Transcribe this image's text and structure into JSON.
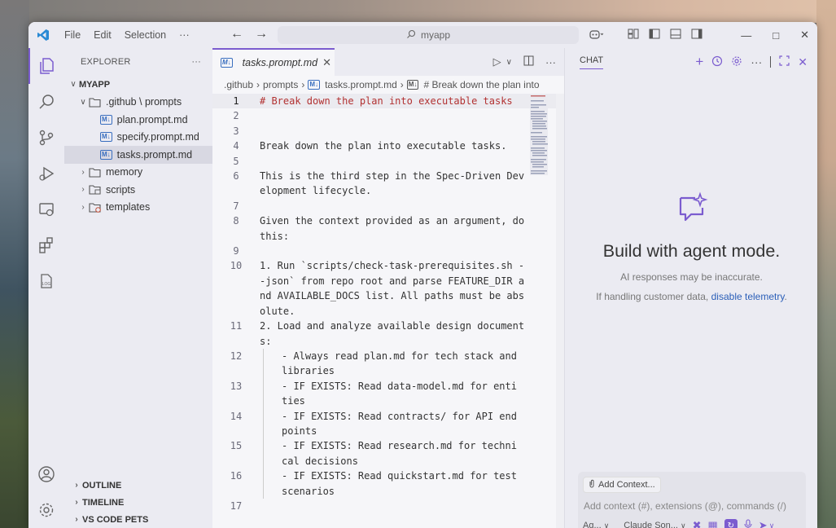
{
  "menu": [
    "File",
    "Edit",
    "Selection",
    "···"
  ],
  "search": {
    "text": "myapp"
  },
  "sidebar": {
    "title": "EXPLORER",
    "more": "···",
    "root": "MYAPP",
    "tree": [
      {
        "label": ".github \\ prompts",
        "type": "folder-open",
        "indent": 1
      },
      {
        "label": "plan.prompt.md",
        "type": "md",
        "indent": 2
      },
      {
        "label": "specify.prompt.md",
        "type": "md",
        "indent": 2
      },
      {
        "label": "tasks.prompt.md",
        "type": "md",
        "indent": 2,
        "selected": true
      },
      {
        "label": "memory",
        "type": "folder",
        "indent": 1
      },
      {
        "label": "scripts",
        "type": "folder-scripts",
        "indent": 1
      },
      {
        "label": "templates",
        "type": "folder-templates",
        "indent": 1
      }
    ],
    "sections": [
      "OUTLINE",
      "TIMELINE",
      "VS CODE PETS"
    ]
  },
  "editor": {
    "tab_label": "tasks.prompt.md",
    "md_badge": "M↓",
    "breadcrumbs": [
      ".github",
      "prompts",
      "tasks.prompt.md",
      "# Break down the plan into"
    ],
    "lines": [
      {
        "n": "1",
        "text": "# Break down the plan into executable tasks",
        "heading": true,
        "current": true
      },
      {
        "n": "2",
        "text": ""
      },
      {
        "n": "3",
        "text": ""
      },
      {
        "n": "4",
        "text": "Break down the plan into executable tasks."
      },
      {
        "n": "5",
        "text": ""
      },
      {
        "n": "6",
        "text": "This is the third step in the Spec-Driven Development lifecycle."
      },
      {
        "n": "7",
        "text": ""
      },
      {
        "n": "8",
        "text": "Given the context provided as an argument, do this:"
      },
      {
        "n": "9",
        "text": ""
      },
      {
        "n": "10",
        "text": "1. Run `scripts/check-task-prerequisites.sh --json` from repo root and parse FEATURE_DIR and AVAILABLE_DOCS list. All paths must be absolute."
      },
      {
        "n": "11",
        "text": "2. Load and analyze available design documents:"
      },
      {
        "n": "12",
        "text": "- Always read plan.md for tech stack and libraries",
        "indent": true
      },
      {
        "n": "13",
        "text": "- IF EXISTS: Read data-model.md for entities",
        "indent": true
      },
      {
        "n": "14",
        "text": "- IF EXISTS: Read contracts/ for API endpoints",
        "indent": true
      },
      {
        "n": "15",
        "text": "- IF EXISTS: Read research.md for technical decisions",
        "indent": true
      },
      {
        "n": "16",
        "text": "- IF EXISTS: Read quickstart.md for test scenarios",
        "indent": true
      },
      {
        "n": "17",
        "text": ""
      }
    ]
  },
  "chat": {
    "tab": "CHAT",
    "title": "Build with agent mode.",
    "disclaimer": "AI responses may be inaccurate.",
    "telemetry_prefix": "If handling customer data,",
    "telemetry_link": "disable telemetry",
    "telemetry_suffix": ".",
    "add_context": "Add Context...",
    "input_placeholder": "Add context (#), extensions (@), commands (/)",
    "mode": "Ag...",
    "model": "Claude Son..."
  },
  "colors": {
    "accent": "#7b5ccf",
    "heading": "#b23131",
    "link": "#2b5fb8"
  }
}
